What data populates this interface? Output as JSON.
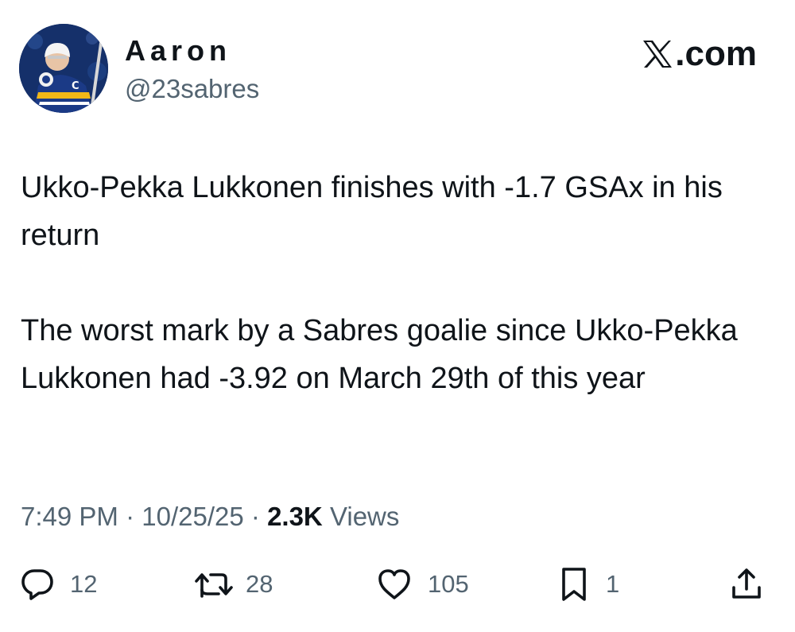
{
  "user": {
    "display_name": "Aaron",
    "handle": "@23sabres",
    "avatar_icon": "hockey-player-avatar"
  },
  "brand": {
    "label": ".com",
    "icon": "x-logo-icon"
  },
  "tweet": {
    "paragraphs": [
      "Ukko-Pekka Lukkonen finishes with -1.7 GSAx in his return",
      "The worst mark by a Sabres goalie since Ukko-Pekka Lukkonen had -3.92 on March 29th of this year"
    ]
  },
  "meta": {
    "time": "7:49 PM",
    "separator": "·",
    "date": "10/25/25",
    "views_count": "2.3K",
    "views_label": "Views"
  },
  "actions": {
    "replies": {
      "icon": "reply-icon",
      "count": "12"
    },
    "reposts": {
      "icon": "repost-icon",
      "count": "28"
    },
    "likes": {
      "icon": "heart-icon",
      "count": "105"
    },
    "bookmarks": {
      "icon": "bookmark-icon",
      "count": "1"
    },
    "share": {
      "icon": "share-icon"
    }
  },
  "colors": {
    "text_primary": "#0f1419",
    "text_secondary": "#536471",
    "avatar_bg": "#15306a",
    "jersey": "#1b3a86",
    "jersey_accent": "#f2b817"
  }
}
